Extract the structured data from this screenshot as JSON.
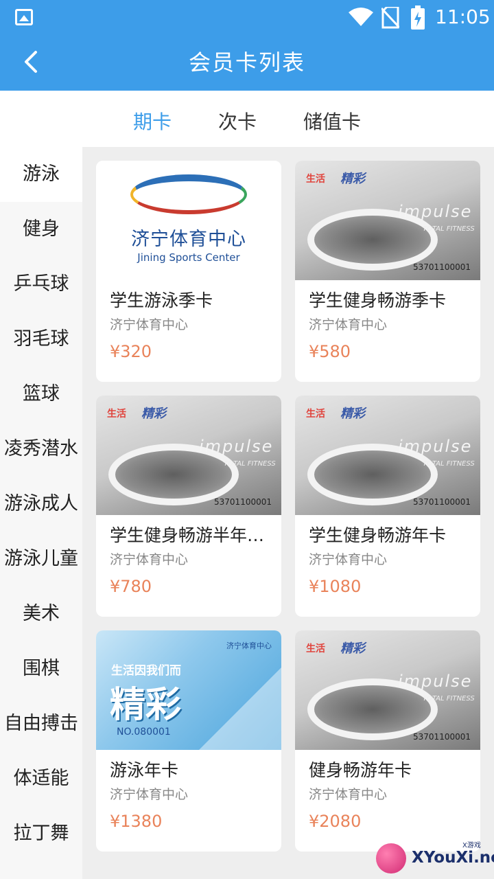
{
  "status": {
    "time": "11:05"
  },
  "header": {
    "title": "会员卡列表"
  },
  "tabs": [
    {
      "label": "期卡"
    },
    {
      "label": "次卡"
    },
    {
      "label": "储值卡"
    }
  ],
  "categories": [
    {
      "label": "游泳"
    },
    {
      "label": "健身"
    },
    {
      "label": "乒乓球"
    },
    {
      "label": "羽毛球"
    },
    {
      "label": "篮球"
    },
    {
      "label": "凌秀潜水"
    },
    {
      "label": "游泳成人"
    },
    {
      "label": "游泳儿童"
    },
    {
      "label": "美术"
    },
    {
      "label": "围棋"
    },
    {
      "label": "自由搏击"
    },
    {
      "label": "体适能"
    },
    {
      "label": "拉丁舞"
    }
  ],
  "cards": [
    {
      "name": "学生游泳季卡",
      "venue": "济宁体育中心",
      "price": "¥320"
    },
    {
      "name": "学生健身畅游季卡",
      "venue": "济宁体育中心",
      "price": "¥580"
    },
    {
      "name": "学生健身畅游半年…",
      "venue": "济宁体育中心",
      "price": "¥780"
    },
    {
      "name": "学生健身畅游年卡",
      "venue": "济宁体育中心",
      "price": "¥1080"
    },
    {
      "name": "游泳年卡",
      "venue": "济宁体育中心",
      "price": "¥1380"
    },
    {
      "name": "健身畅游年卡",
      "venue": "济宁体育中心",
      "price": "¥2080"
    }
  ],
  "card_art": {
    "logo_cn": "济宁体育中心",
    "logo_en": "Jining Sports Center",
    "gray_brand": "生活",
    "gray_brand2": "精彩",
    "gray_impulse": "impulse",
    "gray_fitness": "TOTAL FITNESS",
    "gray_number": "53701100001",
    "blue_line1": "生活因我们而",
    "blue_line2": "精彩",
    "blue_number": "NO.080001",
    "blue_logo": "济宁体育中心"
  },
  "watermark": {
    "text": "XYouXi.net",
    "small": "X游戏"
  },
  "colors": {
    "primary": "#3d9de9",
    "price": "#e9835a"
  }
}
